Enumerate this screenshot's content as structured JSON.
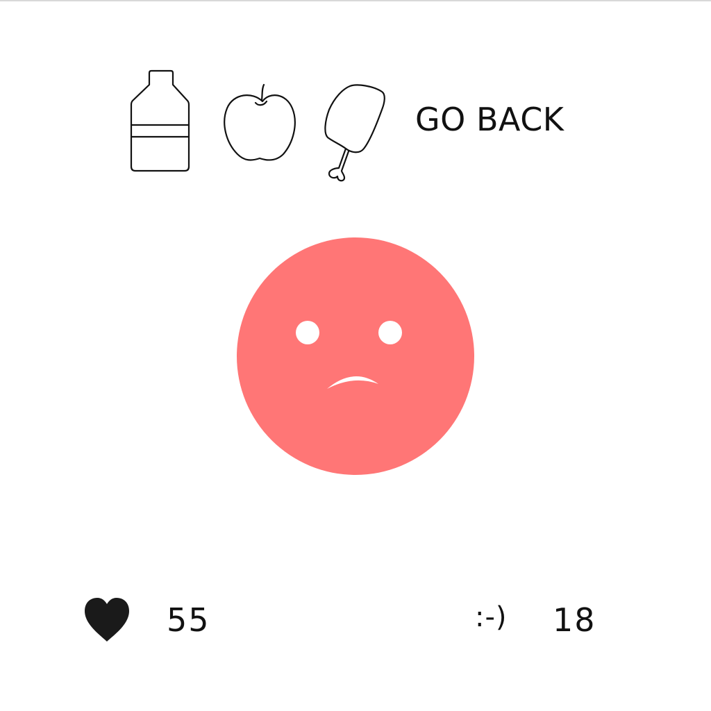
{
  "toolbar": {
    "items": [
      {
        "icon": "bottle-icon"
      },
      {
        "icon": "apple-icon"
      },
      {
        "icon": "drumstick-icon"
      }
    ],
    "go_back_label": "GO BACK"
  },
  "pet": {
    "mood": "sad",
    "face_color": "#ff7676",
    "feature_color": "#ffffff"
  },
  "status": {
    "health_icon": "heart-icon",
    "health_value": "55",
    "mood_icon_text": ":-)",
    "mood_value": "18"
  }
}
